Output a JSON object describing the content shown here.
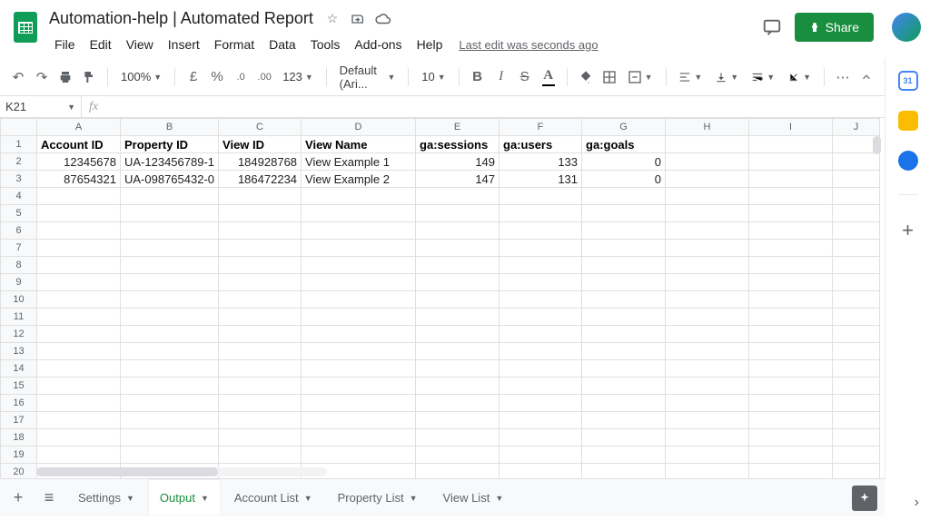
{
  "doc_title": "Automation-help | Automated Report",
  "menu": [
    "File",
    "Edit",
    "View",
    "Insert",
    "Format",
    "Data",
    "Tools",
    "Add-ons",
    "Help"
  ],
  "last_edit": "Last edit was seconds ago",
  "share_label": "Share",
  "zoom": "100%",
  "currency": "£",
  "percent": "%",
  "format_num": "123",
  "font_name": "Default (Ari...",
  "font_size": "10",
  "name_box": "K21",
  "columns": [
    "A",
    "B",
    "C",
    "D",
    "E",
    "F",
    "G",
    "H",
    "I",
    "J"
  ],
  "rows": 20,
  "headers": [
    "Account ID",
    "Property ID",
    "View ID",
    "View Name",
    "ga:sessions",
    "ga:users",
    "ga:goals"
  ],
  "data": [
    [
      "12345678",
      "UA-123456789-1",
      "184928768",
      "View Example 1",
      "149",
      "133",
      "0"
    ],
    [
      "87654321",
      "UA-098765432-0",
      "186472234",
      "View Example 2",
      "147",
      "131",
      "0"
    ]
  ],
  "align": [
    "num",
    "txt",
    "num",
    "txt",
    "num",
    "num",
    "num"
  ],
  "tabs": [
    {
      "label": "Settings",
      "active": false
    },
    {
      "label": "Output",
      "active": true
    },
    {
      "label": "Account List",
      "active": false
    },
    {
      "label": "Property List",
      "active": false
    },
    {
      "label": "View List",
      "active": false
    }
  ]
}
